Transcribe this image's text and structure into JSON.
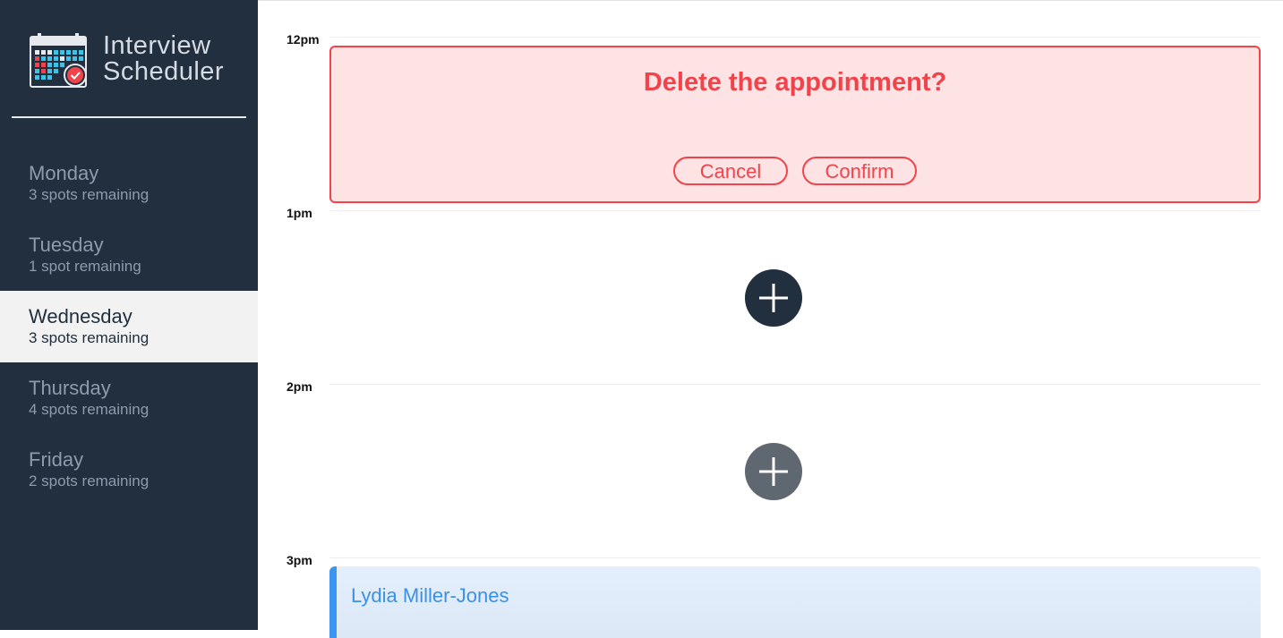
{
  "app": {
    "title_line1": "Interview",
    "title_line2": "Scheduler"
  },
  "days": [
    {
      "name": "Monday",
      "spots": "3 spots remaining",
      "selected": false
    },
    {
      "name": "Tuesday",
      "spots": "1 spot remaining",
      "selected": false
    },
    {
      "name": "Wednesday",
      "spots": "3 spots remaining",
      "selected": true
    },
    {
      "name": "Thursday",
      "spots": "4 spots remaining",
      "selected": false
    },
    {
      "name": "Friday",
      "spots": "2 spots remaining",
      "selected": false
    }
  ],
  "schedule": {
    "hours": [
      "12pm",
      "1pm",
      "2pm",
      "3pm"
    ],
    "confirm": {
      "message": "Delete the appointment?",
      "cancel_label": "Cancel",
      "confirm_label": "Confirm"
    },
    "appointment": {
      "student": "Lydia Miller-Jones"
    }
  },
  "icons": {
    "logo": "calendar-check-icon",
    "add": "plus-icon"
  },
  "colors": {
    "sidebar_bg": "#222f3e",
    "danger": "#f2434a",
    "danger_bg": "#fde3e4",
    "appointment_accent": "#3c95f0",
    "selected_day_bg": "#f2f2f2"
  }
}
